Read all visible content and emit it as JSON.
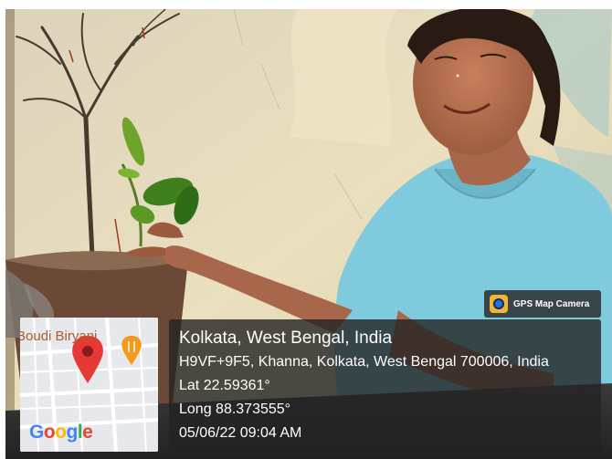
{
  "gps_overlay": {
    "app_badge": {
      "label": "GPS Map Camera",
      "icon": "gps-camera-icon"
    },
    "map": {
      "place_label": "Boudi Biryani",
      "logo_letters": [
        "G",
        "o",
        "o",
        "g",
        "l",
        "e"
      ],
      "pin_color": "#e53935",
      "poi_color": "#f29b1d"
    },
    "location": {
      "city": "Kolkata, West Bengal, India",
      "address": "H9VF+9F5, Khanna, Kolkata, West Bengal 700006, India",
      "latitude": "Lat 22.59361°",
      "longitude": "Long 88.373555°",
      "datetime": "05/06/22 09:04 AM"
    }
  }
}
